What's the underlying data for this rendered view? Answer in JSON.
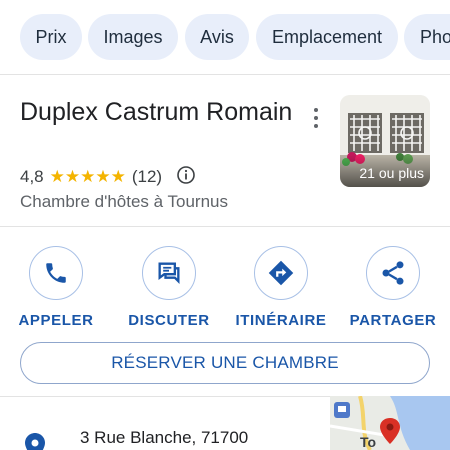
{
  "chips": [
    "Prix",
    "Images",
    "Avis",
    "Emplacement",
    "Pho"
  ],
  "place": {
    "title": "Duplex Castrum Romain",
    "rating": "4,8",
    "stars": "★★★★★",
    "review_count": "(12)",
    "category": "Chambre d'hôtes à Tournus",
    "photo_count_label": "21 ou plus"
  },
  "actions": [
    {
      "label": "APPELER",
      "icon": "phone-icon"
    },
    {
      "label": "DISCUTER",
      "icon": "chat-icon"
    },
    {
      "label": "ITINÉRAIRE",
      "icon": "directions-icon"
    },
    {
      "label": "PARTAGER",
      "icon": "share-icon"
    }
  ],
  "book_button": "RÉSERVER UNE CHAMBRE",
  "address": "3 Rue Blanche, 71700",
  "map_label": "To",
  "colors": {
    "accent": "#1a56a8",
    "chip_bg": "#e8eefa",
    "star": "#f4b400",
    "pin": "#d93025"
  }
}
